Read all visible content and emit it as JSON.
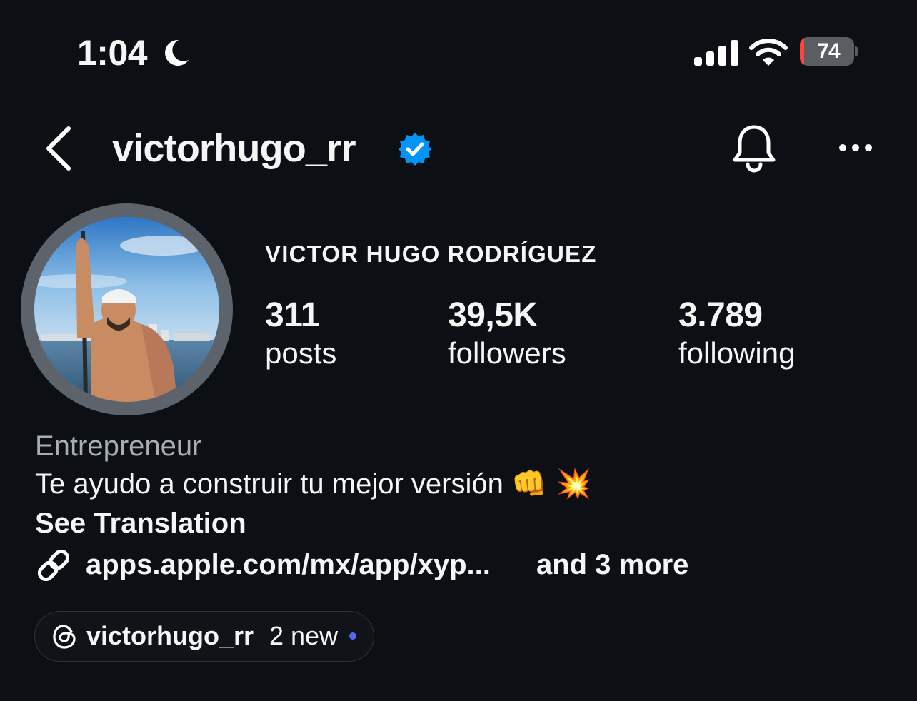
{
  "status_bar": {
    "time": "1:04",
    "focus_icon": "moon-icon",
    "signal_icon": "cellular-signal-icon",
    "wifi_icon": "wifi-icon",
    "battery_level": "74",
    "battery_icon": "battery-charging-icon"
  },
  "header": {
    "back_icon": "chevron-left-icon",
    "username": "victorhugo_rr",
    "verified_icon": "verified-badge-icon",
    "bell_icon": "bell-icon",
    "more_icon": "more-horizontal-icon"
  },
  "profile": {
    "avatar_icon": "profile-photo",
    "full_name": "VICTOR HUGO RODRÍGUEZ",
    "stats": [
      {
        "value": "311",
        "label": "posts"
      },
      {
        "value": "39,5K",
        "label": "followers"
      },
      {
        "value": "3.789",
        "label": "following"
      }
    ]
  },
  "bio": {
    "category": "Entrepreneur",
    "text": "Te ayudo a construir tu mejor versión",
    "emojis": "👊 💥",
    "see_translation": "See Translation",
    "link_icon": "link-icon",
    "link": "apps.apple.com/mx/app/xyp...",
    "more_links": "and 3 more"
  },
  "threads": {
    "icon": "threads-icon",
    "username": "victorhugo_rr",
    "new_count": "2 new"
  },
  "colors": {
    "background": "#0c1014",
    "text": "#f5f5f5",
    "muted": "#a8aeb4",
    "verified": "#0095f6",
    "new_dot": "#5865f2",
    "battery_low": "#ff453a"
  }
}
